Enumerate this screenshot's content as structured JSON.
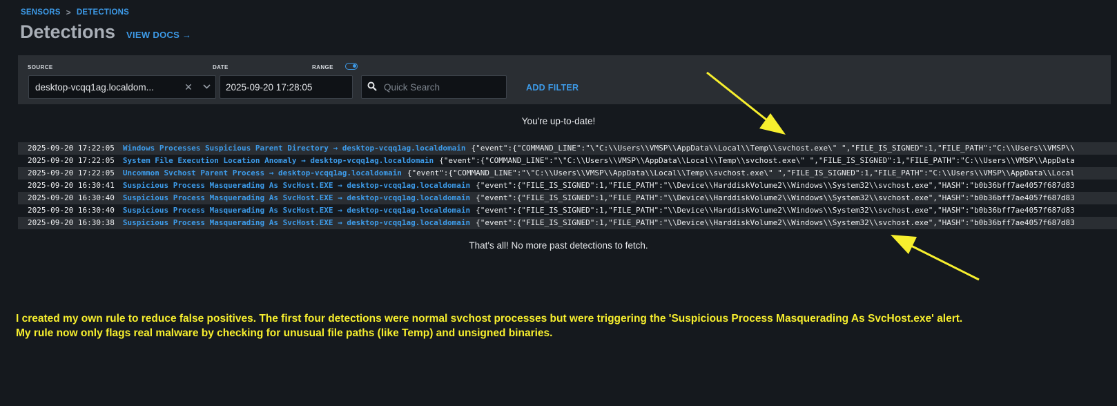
{
  "breadcrumb": {
    "items": [
      "SENSORS",
      "DETECTIONS"
    ],
    "separator": ">"
  },
  "header": {
    "title": "Detections",
    "docs_link": "VIEW DOCS →"
  },
  "filters": {
    "source_label": "SOURCE",
    "source_value": "desktop-vcqq1ag.localdom...",
    "date_label": "DATE",
    "date_value": "2025-09-20 17:28:05",
    "range_label": "RANGE",
    "search_placeholder": "Quick Search",
    "add_filter_label": "ADD FILTER"
  },
  "status": {
    "top": "You're up-to-date!",
    "bottom": "That's all! No more past detections to fetch."
  },
  "detections": [
    {
      "time": "2025-09-20 17:22:05",
      "detection": "Windows Processes Suspicious Parent Directory → desktop-vcqq1ag.localdomain",
      "event": "{\"event\":{\"COMMAND_LINE\":\"\\\"C:\\\\Users\\\\VMSP\\\\AppData\\\\Local\\\\Temp\\\\svchost.exe\\\" \",\"FILE_IS_SIGNED\":1,\"FILE_PATH\":\"C:\\\\Users\\\\VMSP\\\\"
    },
    {
      "time": "2025-09-20 17:22:05",
      "detection": "System File Execution Location Anomaly → desktop-vcqq1ag.localdomain",
      "event": "{\"event\":{\"COMMAND_LINE\":\"\\\"C:\\\\Users\\\\VMSP\\\\AppData\\\\Local\\\\Temp\\\\svchost.exe\\\" \",\"FILE_IS_SIGNED\":1,\"FILE_PATH\":\"C:\\\\Users\\\\VMSP\\\\AppData"
    },
    {
      "time": "2025-09-20 17:22:05",
      "detection": "Uncommon Svchost Parent Process → desktop-vcqq1ag.localdomain",
      "event": "{\"event\":{\"COMMAND_LINE\":\"\\\"C:\\\\Users\\\\VMSP\\\\AppData\\\\Local\\\\Temp\\\\svchost.exe\\\" \",\"FILE_IS_SIGNED\":1,\"FILE_PATH\":\"C:\\\\Users\\\\VMSP\\\\AppData\\\\Local"
    },
    {
      "time": "2025-09-20 16:30:41",
      "detection": "Suspicious Process Masquerading As SvcHost.EXE → desktop-vcqq1ag.localdomain",
      "event": "{\"event\":{\"FILE_IS_SIGNED\":1,\"FILE_PATH\":\"\\\\Device\\\\HarddiskVolume2\\\\Windows\\\\System32\\\\svchost.exe\",\"HASH\":\"b0b36bff7ae4057f687d83"
    },
    {
      "time": "2025-09-20 16:30:40",
      "detection": "Suspicious Process Masquerading As SvcHost.EXE → desktop-vcqq1ag.localdomain",
      "event": "{\"event\":{\"FILE_IS_SIGNED\":1,\"FILE_PATH\":\"\\\\Device\\\\HarddiskVolume2\\\\Windows\\\\System32\\\\svchost.exe\",\"HASH\":\"b0b36bff7ae4057f687d83"
    },
    {
      "time": "2025-09-20 16:30:40",
      "detection": "Suspicious Process Masquerading As SvcHost.EXE → desktop-vcqq1ag.localdomain",
      "event": "{\"event\":{\"FILE_IS_SIGNED\":1,\"FILE_PATH\":\"\\\\Device\\\\HarddiskVolume2\\\\Windows\\\\System32\\\\svchost.exe\",\"HASH\":\"b0b36bff7ae4057f687d83"
    },
    {
      "time": "2025-09-20 16:30:38",
      "detection": "Suspicious Process Masquerading As SvcHost.EXE → desktop-vcqq1ag.localdomain",
      "event": "{\"event\":{\"FILE_IS_SIGNED\":1,\"FILE_PATH\":\"\\\\Device\\\\HarddiskVolume2\\\\Windows\\\\System32\\\\svchost.exe\",\"HASH\":\"b0b36bff7ae4057f687d83"
    }
  ],
  "annotation": {
    "line1": "I created my own rule to reduce false positives. The first four detections were normal svchost processes but were triggering the 'Suspicious Process Masquerading As SvcHost.exe' alert.",
    "line2": "My rule now only flags real malware by checking for unusual file paths (like Temp) and unsigned binaries."
  },
  "colors": {
    "accent": "#3d9be9",
    "background": "#15191e",
    "panel": "#2a2e33",
    "annotation": "#f7ef2e"
  },
  "icons": {
    "search": "search-icon",
    "clear": "close-icon",
    "dropdown": "chevron-down-icon",
    "toggle": "toggle-icon",
    "breadcrumb_sep": "chevron-right-icon"
  }
}
